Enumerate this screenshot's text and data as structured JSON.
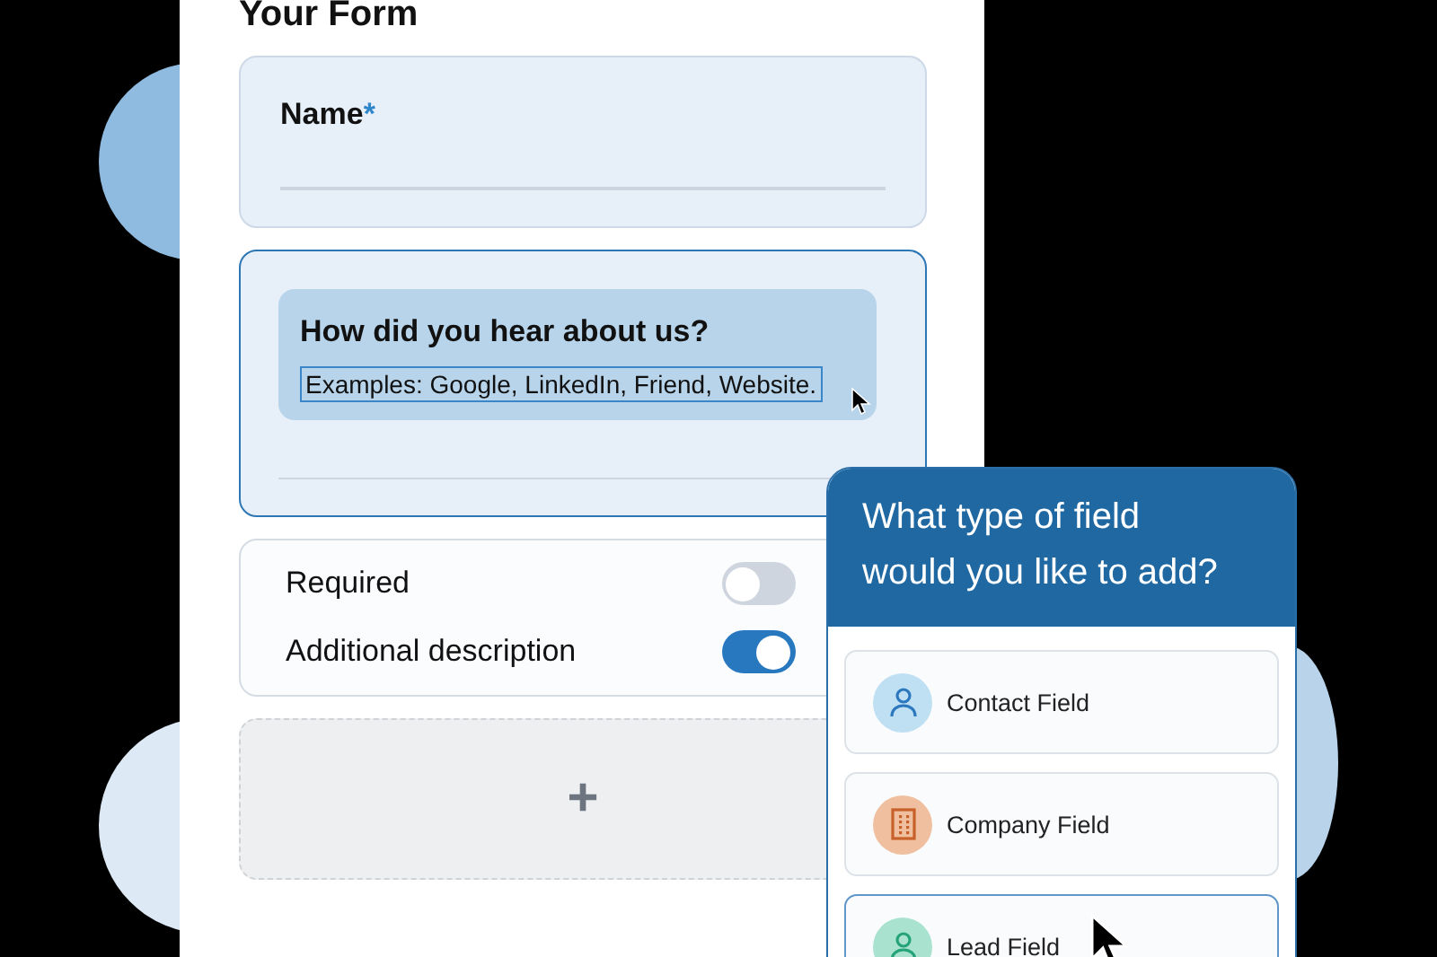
{
  "form": {
    "title": "Your Form",
    "fields": [
      {
        "kind": "short",
        "label": "Name",
        "required_mark": "*",
        "selected": false
      },
      {
        "kind": "question",
        "label": "How did you hear about us?",
        "description": "Examples: Google, LinkedIn, Friend, Website.",
        "selected": true
      }
    ],
    "settings": [
      {
        "label": "Required",
        "on": false
      },
      {
        "label": "Additional description",
        "on": true
      }
    ],
    "add_button": {
      "label": "+"
    }
  },
  "picker": {
    "title": "What type of field would you like to add?",
    "options": [
      {
        "label": "Contact Field",
        "kind": "contact",
        "selected": false
      },
      {
        "label": "Company Field",
        "kind": "company",
        "selected": false
      },
      {
        "label": "Lead Field",
        "kind": "lead",
        "selected": true
      }
    ]
  }
}
